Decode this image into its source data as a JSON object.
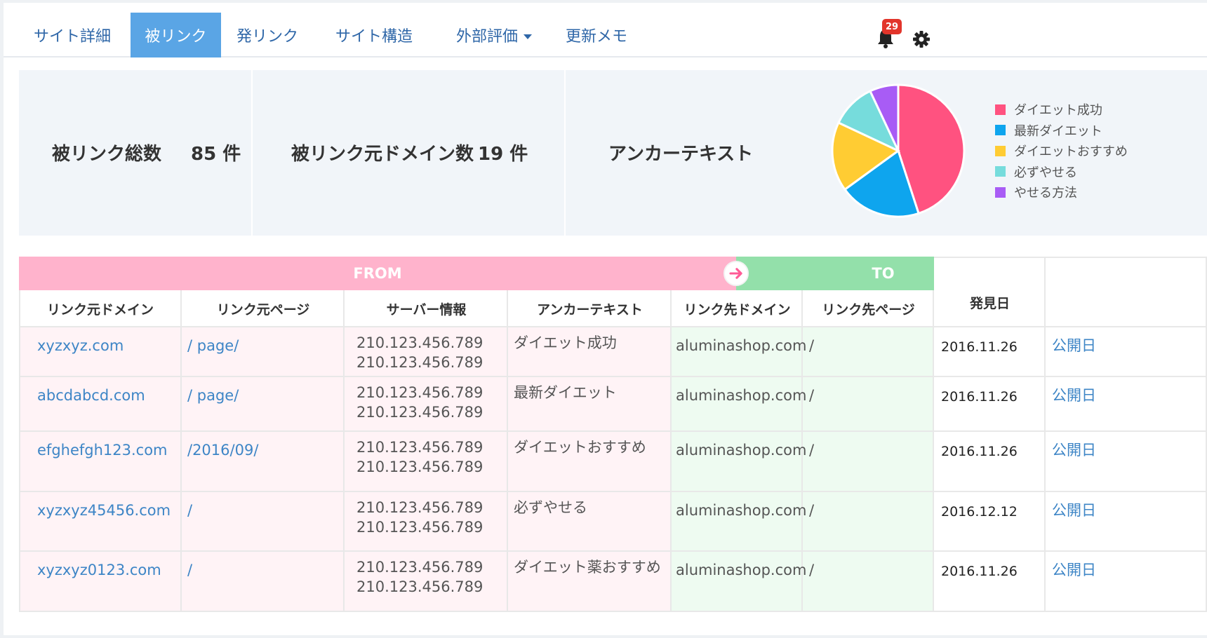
{
  "nav": {
    "tabs": [
      {
        "label": "サイト詳細",
        "name": "tab-site-details"
      },
      {
        "label": "被リンク",
        "name": "tab-backlinks",
        "active": true
      },
      {
        "label": "発リンク",
        "name": "tab-outbound-links"
      },
      {
        "label": "サイト構造",
        "name": "tab-site-structure"
      },
      {
        "label": "外部評価",
        "name": "tab-external-evaluation",
        "dropdown": true
      },
      {
        "label": "更新メモ",
        "name": "tab-update-memo"
      }
    ],
    "notification_count": "29",
    "icons": [
      "bell-icon",
      "gear-icon"
    ]
  },
  "summary": {
    "backlink_total_label": "被リンク総数",
    "backlink_total_value": "85 件",
    "domain_count_label": "被リンク元ドメイン数",
    "domain_count_value": "19 件",
    "anchor_text_label": "アンカーテキスト"
  },
  "chart_data": {
    "type": "pie",
    "categories": [
      "ダイエット成功",
      "最新ダイエット",
      "ダイエットおすすめ",
      "必ずやせる",
      "やせる方法"
    ],
    "values": [
      45,
      20,
      17,
      11,
      7
    ],
    "colors": [
      "#ff5280",
      "#0ea5ee",
      "#ffcc33",
      "#76dcdc",
      "#a85cf5"
    ],
    "legend": "right"
  },
  "table": {
    "from_label": "FROM",
    "to_label": "TO",
    "headers": {
      "source_domain": "リンク元ドメイン",
      "source_page": "リンク元ページ",
      "server_info": "サーバー情報",
      "anchor_text": "アンカーテキスト",
      "target_domain": "リンク先ドメイン",
      "target_page": "リンク先ページ",
      "found_date": "発見日"
    },
    "rows": [
      {
        "source_domain": "xyzxyz.com",
        "source_page": "/ page/",
        "server_ip1": "210.123.456.789",
        "server_ip2": "210.123.456.789",
        "anchor": "ダイエット成功",
        "target_domain": "aluminashop.com",
        "target_page": "/",
        "date": "2016.11.26",
        "extra": "公開日"
      },
      {
        "source_domain": "abcdabcd.com",
        "source_page": "/ page/",
        "server_ip1": "210.123.456.789",
        "server_ip2": "210.123.456.789",
        "anchor": "最新ダイエット",
        "target_domain": "aluminashop.com",
        "target_page": "/",
        "date": "2016.11.26",
        "extra": "公開日"
      },
      {
        "source_domain": "efghefgh123.com",
        "source_page": "/2016/09/",
        "server_ip1": "210.123.456.789",
        "server_ip2": "210.123.456.789",
        "anchor": "ダイエットおすすめ",
        "target_domain": "aluminashop.com",
        "target_page": "/",
        "date": "2016.11.26",
        "extra": "公開日"
      },
      {
        "source_domain": "xyzxyz45456.com",
        "source_page": "/",
        "server_ip1": "210.123.456.789",
        "server_ip2": "210.123.456.789",
        "anchor": "必ずやせる",
        "target_domain": "aluminashop.com",
        "target_page": "/",
        "date": "2016.12.12",
        "extra": "公開日"
      },
      {
        "source_domain": "xyzxyz0123.com",
        "source_page": "/",
        "server_ip1": "210.123.456.789",
        "server_ip2": "210.123.456.789",
        "anchor": "ダイエット薬おすすめ",
        "target_domain": "aluminashop.com",
        "target_page": "/",
        "date": "2016.11.26",
        "extra": "公開日"
      }
    ]
  }
}
